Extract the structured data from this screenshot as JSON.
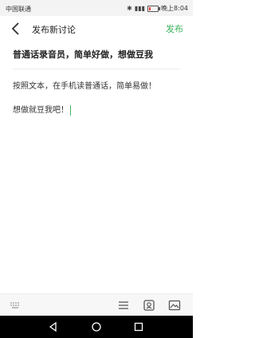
{
  "status_bar": {
    "carrier": "中国联通",
    "time": "晚上8:04",
    "battery_level": 0.2,
    "icons": [
      "bluetooth-icon",
      "signal-icon",
      "battery-icon"
    ]
  },
  "header": {
    "title": "发布新讨论",
    "publish_label": "发布",
    "back_icon": "chevron-left-icon"
  },
  "post": {
    "title": "普通话录音员，简单好做，想做豆我",
    "body_lines": [
      "按照文本，在手机读普通话，简单易做！",
      "想做就豆我吧！"
    ]
  },
  "toolbar": {
    "icons": [
      "keyboard-icon",
      "text-format-icon",
      "emoji-icon",
      "image-icon"
    ]
  },
  "nav_bar": {
    "icons": [
      "nav-back-icon",
      "nav-home-icon",
      "nav-recent-icon"
    ]
  },
  "colors": {
    "accent": "#3cb35a",
    "battery_low": "#e53935"
  }
}
